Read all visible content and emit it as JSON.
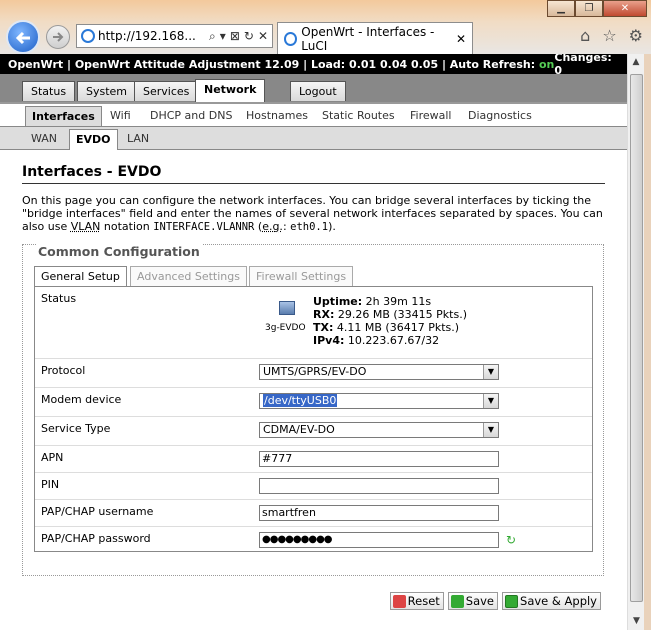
{
  "browser": {
    "address": "http://192.168...",
    "tab_title": "OpenWrt - Interfaces - LuCI",
    "tab_close": "✕",
    "window_buttons": [
      "▁",
      "❐",
      "✕"
    ]
  },
  "topbar": {
    "prefix": "OpenWrt | OpenWrt Attitude Adjustment 12.09 | Load: 0.01 0.04 0.05 | Auto Refresh: ",
    "auto_refresh": "on",
    "changes": "Changes: 0"
  },
  "menu_main": [
    "Status",
    "System",
    "Services",
    "Network",
    "Logout"
  ],
  "menu_network": [
    "Interfaces",
    "Wifi",
    "DHCP and DNS",
    "Hostnames",
    "Static Routes",
    "Firewall",
    "Diagnostics"
  ],
  "menu_ifaces": [
    "WAN",
    "EVDO",
    "LAN"
  ],
  "page_title": "Interfaces - EVDO",
  "desc": {
    "part1": "On this page you can configure the network interfaces. You can bridge several interfaces by ticking the \"bridge interfaces\" field and enter the names of several network interfaces separated by spaces. You can also use ",
    "vlan": "VLAN",
    "part2": " notation ",
    "code1": "INTERFACE.VLANNR",
    "part3": " (",
    "eg": "e.g.",
    "part4": ": ",
    "code2": "eth0.1",
    "part5": ")."
  },
  "section_title": "Common Configuration",
  "config_tabs": [
    "General Setup",
    "Advanced Settings",
    "Firewall Settings"
  ],
  "status": {
    "label": "Status",
    "device": "3g-EVDO",
    "uptime_k": "Uptime:",
    "uptime_v": " 2h 39m 11s",
    "rx_k": "RX:",
    "rx_v": " 29.26 MB (33415 Pkts.)",
    "tx_k": "TX:",
    "tx_v": " 4.11 MB (36417 Pkts.)",
    "ipv4_k": "IPv4:",
    "ipv4_v": " 10.223.67.67/32"
  },
  "fields": {
    "protocol": {
      "label": "Protocol",
      "value": "UMTS/GPRS/EV-DO"
    },
    "modem": {
      "label": "Modem device",
      "value": "/dev/ttyUSB0"
    },
    "service": {
      "label": "Service Type",
      "value": "CDMA/EV-DO"
    },
    "apn": {
      "label": "APN",
      "value": "#777"
    },
    "pin": {
      "label": "PIN",
      "value": ""
    },
    "user": {
      "label": "PAP/CHAP username",
      "value": "smartfren"
    },
    "pass": {
      "label": "PAP/CHAP password",
      "value": "●●●●●●●●●"
    }
  },
  "buttons": {
    "reset": "Reset",
    "save": "Save",
    "apply": "Save & Apply"
  },
  "icons": [
    "back-icon",
    "forward-icon",
    "ie-icon",
    "search-icon",
    "refresh-icon",
    "home-icon",
    "favorites-icon",
    "gear-icon",
    "network-device-icon",
    "reveal-password-icon"
  ]
}
